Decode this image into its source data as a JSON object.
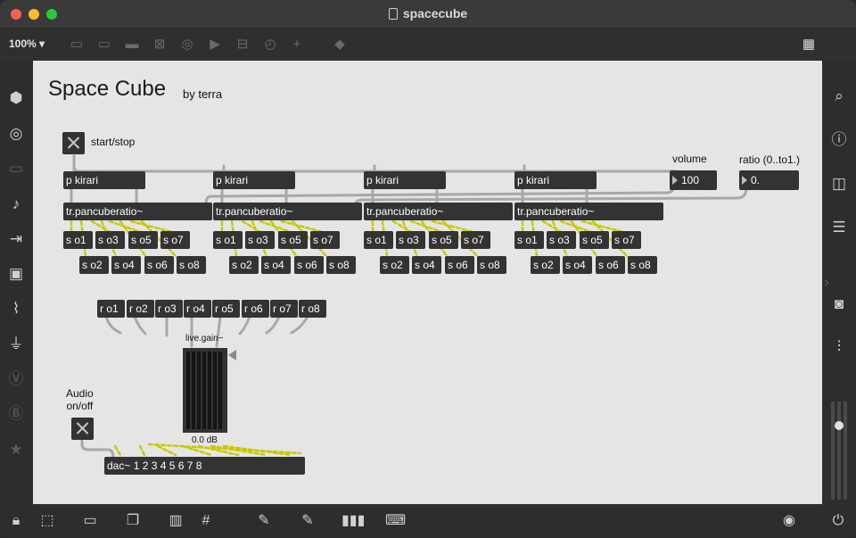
{
  "window": {
    "title": "spacecube"
  },
  "toolbar": {
    "zoom": "100%"
  },
  "patch": {
    "title": "Space Cube",
    "byline": "by terra",
    "start_stop_label": "start/stop",
    "volume_label": "volume",
    "volume_value": "100",
    "ratio_label": "ratio (0..to1.)",
    "ratio_value": "0.",
    "kirari": [
      "p kirari",
      "p kirari",
      "p kirari",
      "p kirari"
    ],
    "pancube": [
      "tr.pancuberatio~",
      "tr.pancuberatio~",
      "tr.pancuberatio~",
      "tr.pancuberatio~"
    ],
    "send_top": [
      "s o1",
      "s o3",
      "s o5",
      "s o7"
    ],
    "send_bottom": [
      "s o2",
      "s o4",
      "s o6",
      "s o8"
    ],
    "receives": [
      "r o1",
      "r o2",
      "r o3",
      "r o4",
      "r o5",
      "r o6",
      "r o7",
      "r o8"
    ],
    "gain_label": "live.gain~",
    "gain_value": "0.0 dB",
    "audio_label": "Audio\non/off",
    "dac": "dac~ 1 2 3 4 5 6 7 8"
  },
  "icons": {
    "left_sidebar": [
      "cube-icon",
      "target-icon",
      "display-icon",
      "music-note-icon",
      "media-step-icon",
      "image-icon",
      "paperclip-icon",
      "plug-icon",
      "vizzie-icon",
      "beap-icon",
      "star-icon"
    ],
    "right_sidebar": [
      "search-icon",
      "info-icon",
      "columns-icon",
      "list-icon",
      "camera-icon",
      "sliders-icon",
      "power-icon"
    ],
    "bottom_bar": [
      "lock-icon",
      "presentation-icon",
      "screen-icon",
      "windows-icon",
      "mute-icon",
      "grid-icon",
      "debug-icon",
      "wrench-icon",
      "piano-icon",
      "keyboard-icon",
      "transport-icon"
    ]
  },
  "colors": {
    "canvas": "#e5e5e5",
    "object": "#333333",
    "window": "#2d2d2d",
    "patch_cord": "#a8a8a8",
    "signal_cord": "#c9c900"
  }
}
